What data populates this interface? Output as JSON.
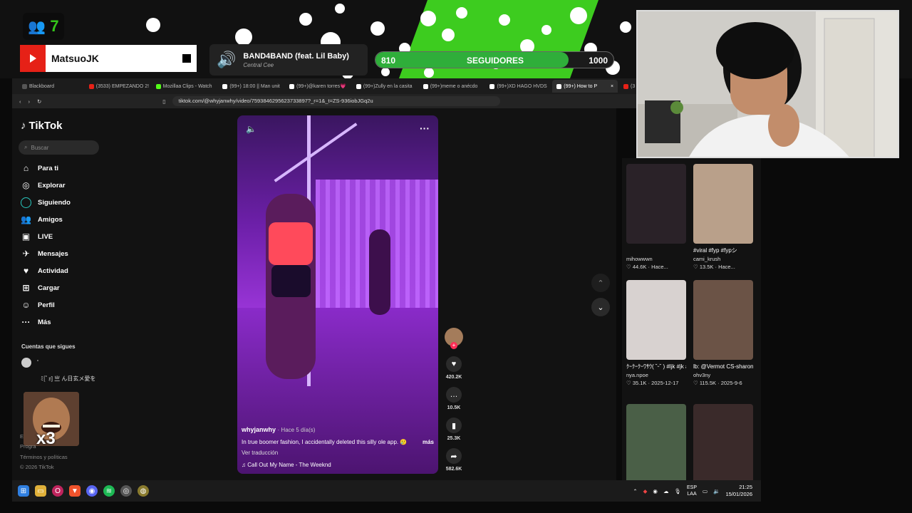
{
  "overlay": {
    "viewer_count": "7",
    "channel_name": "MatsuoJK",
    "music": {
      "title": "BAND4BAND (feat. Lil Baby)",
      "artist": "Central Cee"
    },
    "followers": {
      "current": "810",
      "label": "SEGUIDORES",
      "goal": "1000",
      "progress": 0.81
    }
  },
  "browser": {
    "tabs": [
      {
        "label": "Blackboard",
        "color": "#555555",
        "active": false
      },
      {
        "label": "(3533) EMPEZANDO 2!",
        "color": "#e62117",
        "active": false
      },
      {
        "label": "Mozillaa Clips - Watch",
        "color": "#53fc18",
        "active": false
      },
      {
        "label": "(99+) 18:00 || Man unit",
        "color": "#ffffff",
        "active": false
      },
      {
        "label": "(99+)@karen torres💗",
        "color": "#ffffff",
        "active": false
      },
      {
        "label": "(99+)Zully en la casita",
        "color": "#ffffff",
        "active": false
      },
      {
        "label": "(99+)meme o anécdo",
        "color": "#ffffff",
        "active": false
      },
      {
        "label": "(99+)XD HAGO HVDS",
        "color": "#ffffff",
        "active": false
      },
      {
        "label": "(99+) How to P",
        "color": "#ffffff",
        "active": true
      },
      {
        "label": "(3",
        "color": "#e62117",
        "active": false
      }
    ],
    "url": "tiktok.com/@whyjanwhy/video/7593846295623733897?_r=1&_t=ZS-936iobJGq2u"
  },
  "tiktok": {
    "logo": "TikTok",
    "search_placeholder": "Buscar",
    "nav": [
      {
        "label": "Para ti",
        "icon": "home-icon",
        "glyph": "⌂"
      },
      {
        "label": "Explorar",
        "icon": "compass-icon",
        "glyph": "◎"
      },
      {
        "label": "Siguiendo",
        "icon": "following-icon",
        "glyph": ""
      },
      {
        "label": "Amigos",
        "icon": "friends-icon",
        "glyph": "👥"
      },
      {
        "label": "LIVE",
        "icon": "live-icon",
        "glyph": "▣"
      },
      {
        "label": "Mensajes",
        "icon": "messages-icon",
        "glyph": "✈"
      },
      {
        "label": "Actividad",
        "icon": "activity-icon",
        "glyph": "♥"
      },
      {
        "label": "Cargar",
        "icon": "upload-icon",
        "glyph": "⊞"
      },
      {
        "label": "Perfil",
        "icon": "profile-icon",
        "glyph": "☺"
      },
      {
        "label": "Más",
        "icon": "more-icon",
        "glyph": "···"
      }
    ],
    "following_header": "Cuentas que sigues",
    "followed_accounts": [
      "ﾟ",
      "ﾐ[ﾟｫ] 亗 ん日玄メ愛を"
    ],
    "footer": [
      "E",
      "Progra",
      "Términos y políticas",
      "© 2026 TikTok"
    ],
    "meme_overlay": "x3",
    "video": {
      "username": "whyjanwhy",
      "posted": "· Hace 5 día(s)",
      "caption": "In true boomer fashion, I accidentally deleted this silly ole app. 🥲",
      "more": "más",
      "translate": "Ver traducción",
      "song": "Call Out My Name - The Weeknd"
    },
    "actions": {
      "likes": "420.2K",
      "comments": "10.5K",
      "saves": "25.3K",
      "shares": "582.6K"
    }
  },
  "feed": [
    {
      "caption": "",
      "author": "mihowwwn",
      "likes": "44.6K",
      "date": "Hace...",
      "color": "#2a2228"
    },
    {
      "caption": "#viral #fyp #fypシ",
      "author": "cami_krush",
      "likes": "13.5K",
      "date": "Hace...",
      "color": "#b9a08a"
    },
    {
      "caption": "ｸｰｸｰｸｰﾜｻｳ( ˘ᵕ˘ ) #ljk #jk #地雷 #...",
      "author": "nya.npoe",
      "likes": "35.1K",
      "date": "2025-12-17",
      "color": "#d8d2d0"
    },
    {
      "caption": "lb: @Vermot CS-sharon #fypジ...",
      "author": "ohv3ny",
      "likes": "115.5K",
      "date": "2025-9-6",
      "color": "#6b5346"
    },
    {
      "caption": "",
      "author": "",
      "likes": "",
      "date": "",
      "color": "#4a5f47"
    },
    {
      "caption": "",
      "author": "",
      "likes": "",
      "date": "",
      "color": "#3a2a2a"
    }
  ],
  "taskbar": {
    "lang": [
      "ESP",
      "LAA"
    ],
    "time": "21:25",
    "date": "15/01/2026"
  }
}
